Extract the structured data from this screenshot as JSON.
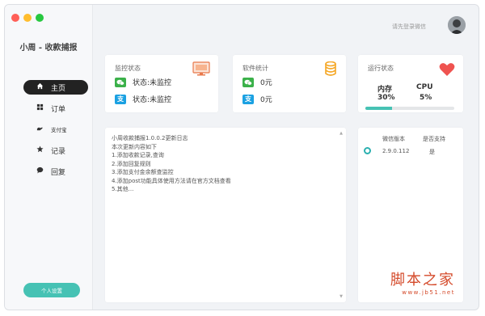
{
  "colors": {
    "close": "#ff5f57",
    "minimize": "#ffbd2e",
    "maximize": "#28c840",
    "accent": "#46c2b4",
    "wechat": "#3bb14a",
    "alipay": "#1ba1e2",
    "heart": "#ef5350",
    "database": "#f5a623"
  },
  "app": {
    "title": "小周 - 收款捕报"
  },
  "header": {
    "login_text": "请先登录微信"
  },
  "sidebar": {
    "items": [
      {
        "icon": "home-icon",
        "label": "主页",
        "active": true
      },
      {
        "icon": "grid-icon",
        "label": "订单",
        "active": false
      },
      {
        "icon": "hand-icon",
        "label": "支付宝",
        "active": false
      },
      {
        "icon": "star-icon",
        "label": "记录",
        "active": false
      },
      {
        "icon": "chat-icon",
        "label": "回复",
        "active": false
      }
    ],
    "personal_button": "个人设置"
  },
  "monitor": {
    "title": "监控状态",
    "wechat_status": "状态:未监控",
    "alipay_status": "状态:未监控"
  },
  "software": {
    "title": "软件统计",
    "wechat_amount": "0元",
    "alipay_amount": "0元"
  },
  "running": {
    "title": "运行状态",
    "memory_label": "内存",
    "cpu_label": "CPU",
    "memory_value": "30%",
    "cpu_value": "5%",
    "memory_fraction": 0.3
  },
  "log": {
    "lines": [
      "小周收款捕报1.0.0.2更新日志",
      "本次更新内容如下",
      "1.添加收款记录,查询",
      "2.添加回复规则",
      "3.添加支付金余额查监控",
      "4.添加post功能具体使用方法请在官方文档查看",
      "5.其他..."
    ]
  },
  "version_panel": {
    "col_version": "微信版本",
    "col_support": "是否支持",
    "version": "2.9.0.112",
    "support": "是"
  },
  "watermark": {
    "main": "脚本之家",
    "url": "www.jb51.net"
  }
}
